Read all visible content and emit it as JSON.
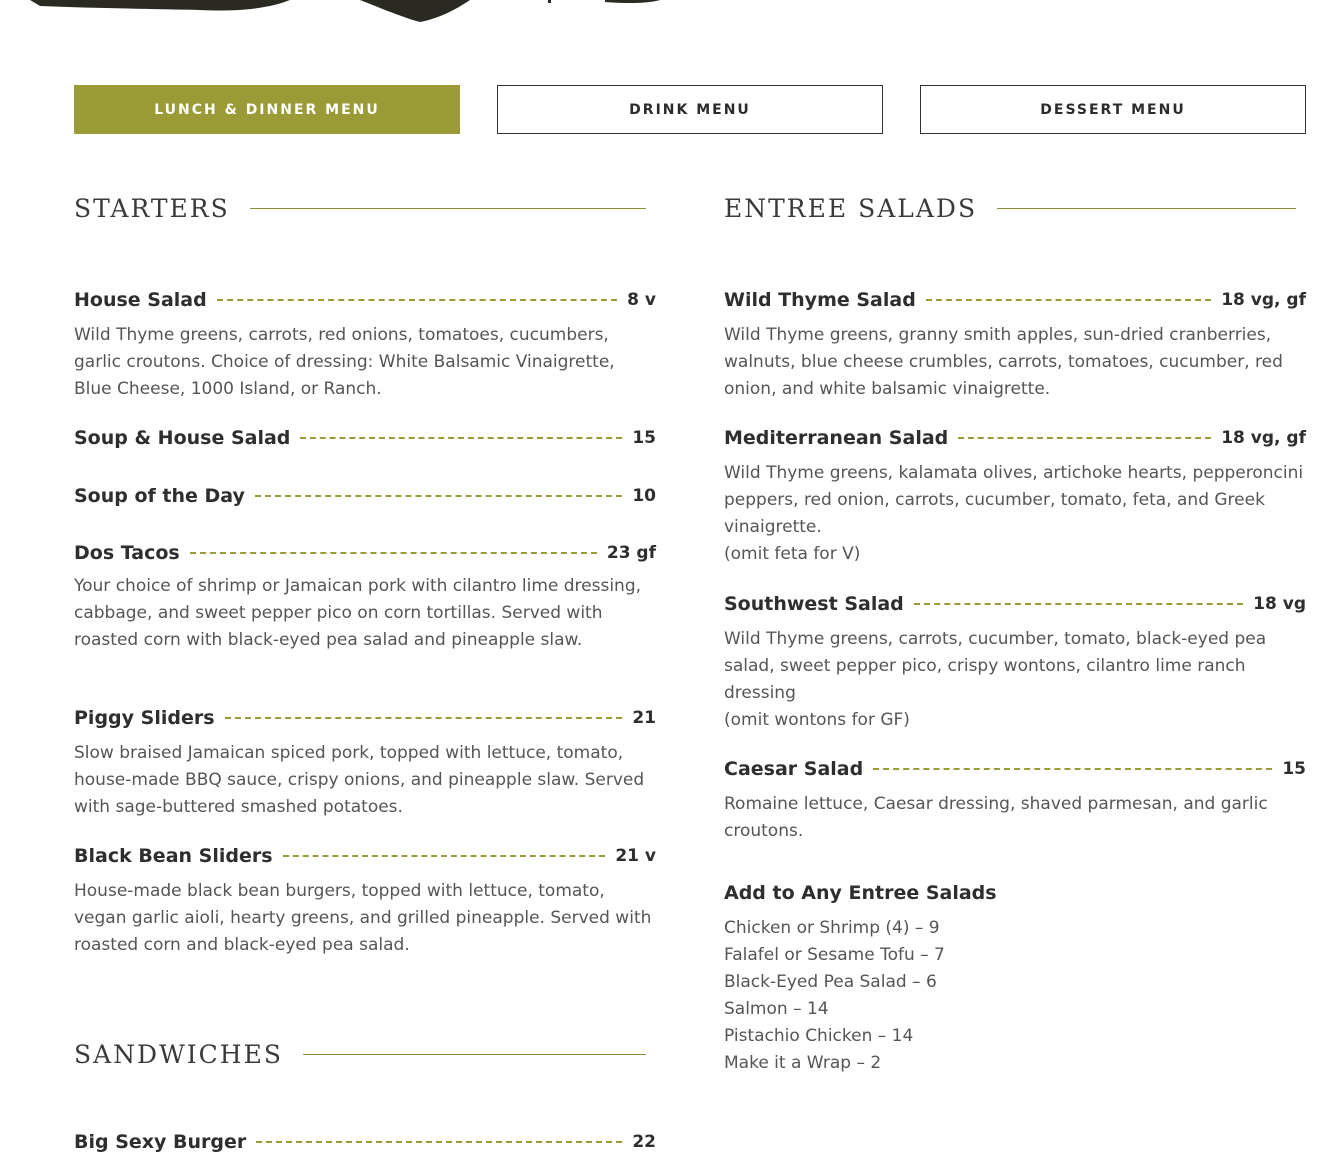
{
  "tabs": [
    {
      "label": "LUNCH & DINNER MENU"
    },
    {
      "label": "DRINK MENU"
    },
    {
      "label": "DESSERT MENU"
    }
  ],
  "colors": {
    "accent": "#9a9a36",
    "text": "#2e2e2e",
    "muted": "#555555"
  },
  "starters": {
    "title": "STARTERS",
    "items": [
      {
        "name": "House Salad",
        "price": "8 v",
        "desc": "Wild Thyme greens, carrots, red onions, tomatoes, cucumbers, garlic croutons. Choice of dressing: White Balsamic Vinaigrette, Blue Cheese, 1000 Island, or Ranch."
      },
      {
        "name": "Soup & House Salad",
        "price": "15",
        "desc": ""
      },
      {
        "name": "Soup of the Day",
        "price": "10",
        "desc": ""
      },
      {
        "name": "Dos Tacos",
        "price": "23 gf",
        "desc": "Your choice of shrimp or Jamaican pork with cilantro lime dressing, cabbage, and sweet pepper pico on corn tortillas. Served with roasted corn with black-eyed pea salad and pineapple slaw."
      },
      {
        "name": "Piggy Sliders",
        "price": "21",
        "desc": "Slow braised Jamaican spiced pork, topped with lettuce, tomato, house-made BBQ sauce, crispy onions, and pineapple slaw. Served with sage-buttered smashed potatoes."
      },
      {
        "name": "Black Bean Sliders",
        "price": "21 v",
        "desc": "House-made black bean burgers, topped with lettuce, tomato, vegan garlic aioli, hearty greens, and grilled pineapple. Served with roasted corn and black-eyed pea salad."
      }
    ]
  },
  "sandwiches": {
    "title": "SANDWICHES",
    "items": [
      {
        "name": "Big Sexy Burger",
        "price": "22"
      }
    ]
  },
  "entree_salads": {
    "title": "ENTREE SALADS",
    "items": [
      {
        "name": "Wild Thyme Salad",
        "price": "18 vg, gf",
        "desc": "Wild Thyme greens, granny smith apples, sun-dried cranberries, walnuts, blue cheese crumbles, carrots, tomatoes, cucumber, red onion, and white balsamic vinaigrette.",
        "note": ""
      },
      {
        "name": "Mediterranean Salad",
        "price": "18 vg, gf",
        "desc": "Wild Thyme greens, kalamata olives, artichoke hearts, pepperoncini peppers, red onion, carrots, cucumber, tomato, feta, and Greek vinaigrette.",
        "note": "(omit feta for V)"
      },
      {
        "name": "Southwest Salad",
        "price": "18 vg",
        "desc": "Wild Thyme greens, carrots, cucumber, tomato, black-eyed pea salad, sweet pepper pico, crispy wontons, cilantro lime ranch dressing",
        "note": "(omit wontons for GF)"
      },
      {
        "name": "Caesar Salad",
        "price": "15",
        "desc": "Romaine lettuce, Caesar dressing, shaved parmesan, and garlic croutons.",
        "note": ""
      }
    ],
    "addons": {
      "title": "Add to Any Entree Salads",
      "lines": [
        "Chicken or Shrimp (4) – 9",
        "Falafel or Sesame Tofu – 7",
        "Black-Eyed Pea Salad – 6",
        "Salmon – 14",
        "Pistachio Chicken – 14",
        "Make it a Wrap – 2"
      ]
    }
  }
}
